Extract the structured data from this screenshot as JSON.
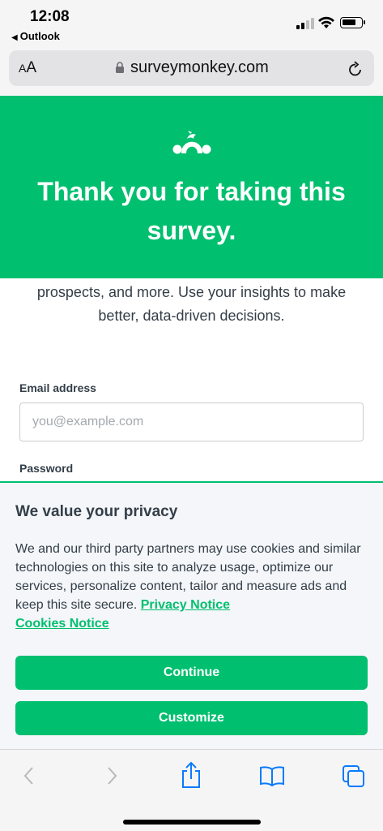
{
  "status_bar": {
    "time": "12:08",
    "back_app": "Outlook"
  },
  "browser": {
    "text_size_label_small": "A",
    "text_size_label_large": "A",
    "url": "surveymonkey.com"
  },
  "hero": {
    "title": "Thank you for taking this survey."
  },
  "main": {
    "description": "prospects, and more. Use your insights to make better, data-driven decisions.",
    "email_label": "Email address",
    "email_placeholder": "you@example.com",
    "email_value": "",
    "password_label": "Password"
  },
  "cookie_banner": {
    "title": "We value your privacy",
    "text": "We and our third party partners may use cookies and similar technologies on this site to analyze usage, optimize our services, personalize content, tailor and measure ads and keep this site secure.",
    "privacy_link": "Privacy Notice",
    "cookies_link": "Cookies Notice",
    "continue_label": "Continue",
    "customize_label": "Customize"
  },
  "colors": {
    "brand_green": "#00bf6f",
    "ios_blue": "#0a7aff"
  },
  "icons": [
    "back-arrow-icon",
    "signal-icon",
    "wifi-icon",
    "battery-icon",
    "lock-icon",
    "reload-icon",
    "surveymonkey-logo-icon",
    "chevron-left-icon",
    "chevron-right-icon",
    "share-icon",
    "bookmarks-icon",
    "tabs-icon"
  ]
}
